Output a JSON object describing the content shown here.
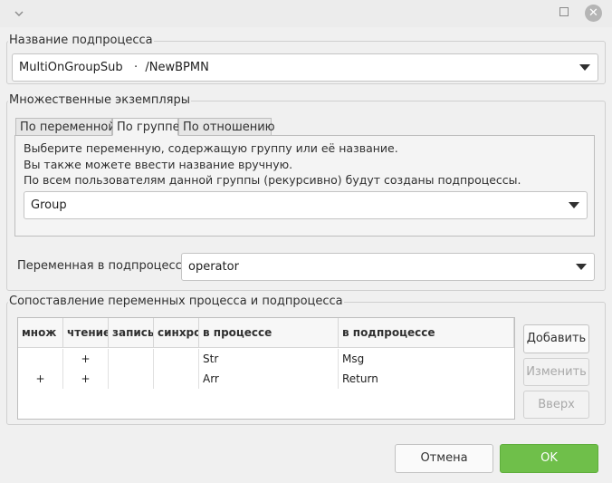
{
  "window": {
    "menu_icon": "chevron-down-icon",
    "maximize_icon": "maximize-icon",
    "close_icon": "close-icon"
  },
  "subprocess": {
    "legend": "Название подпроцесса",
    "value": "MultiOnGroupSub   ·  /NewBPMN"
  },
  "multi": {
    "legend": "Множественные экземпляры",
    "tabs": [
      "По переменной",
      "По группе",
      "По отношению"
    ],
    "active_tab": "По группе",
    "desc_lines": [
      "Выберите переменную, содержащую группу или её название.",
      "Вы также можете ввести название вручную.",
      "По всем пользователям данной группы (рекурсивно) будут созданы подпроцессы."
    ],
    "group_value": "Group",
    "var_label": "Переменная в подпроцессе:",
    "var_value": "operator"
  },
  "mapping": {
    "legend": "Сопоставление переменных процесса и подпроцесса",
    "columns": [
      "множ",
      "чтение",
      "запись",
      "синхро",
      "в процессе",
      "в подпроцессе"
    ],
    "rows": [
      {
        "mult": "",
        "read": "+",
        "write": "",
        "sync": "",
        "process": "Str",
        "subprocess": "Msg"
      },
      {
        "mult": "+",
        "read": "+",
        "write": "",
        "sync": "",
        "process": "Arr",
        "subprocess": "Return"
      }
    ],
    "buttons": {
      "add": "Добавить",
      "edit": "Изменить",
      "up": "Вверх"
    }
  },
  "footer": {
    "cancel": "Отмена",
    "ok": "OK"
  },
  "colors": {
    "ok_button": "#6fbf4a",
    "background": "#f0f0f0"
  }
}
